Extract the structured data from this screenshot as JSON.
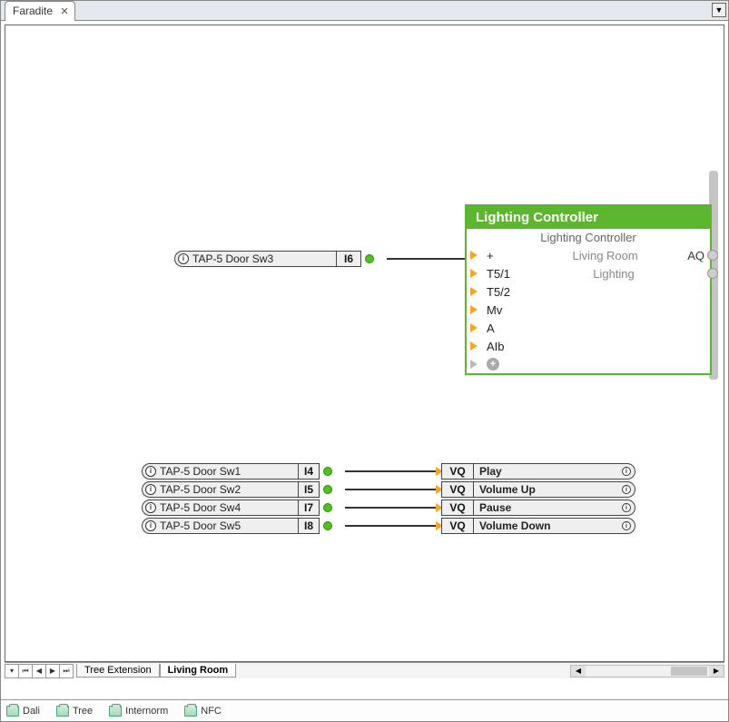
{
  "topTab": {
    "label": "Faradite"
  },
  "inputs": {
    "sw3": {
      "label": "TAP-5 Door Sw3",
      "port": "I6"
    },
    "sw1": {
      "label": "TAP-5 Door Sw1",
      "port": "I4"
    },
    "sw2": {
      "label": "TAP-5 Door Sw2",
      "port": "I5"
    },
    "sw4": {
      "label": "TAP-5 Door Sw4",
      "port": "I7"
    },
    "sw5": {
      "label": "TAP-5 Door Sw5",
      "port": "I8"
    }
  },
  "controller": {
    "title": "Lighting Controller",
    "subtitle": "Lighting Controller",
    "rows": [
      {
        "k": "+",
        "c": "Living Room",
        "r": "AQ"
      },
      {
        "k": "T5/1",
        "c": "Lighting",
        "r": ""
      },
      {
        "k": "T5/2",
        "c": "",
        "r": ""
      },
      {
        "k": "Mv",
        "c": "",
        "r": ""
      },
      {
        "k": "A",
        "c": "",
        "r": ""
      },
      {
        "k": "AIb",
        "c": "",
        "r": ""
      }
    ]
  },
  "outputs": {
    "o1": {
      "port": "VQ",
      "label": "Play"
    },
    "o2": {
      "port": "VQ",
      "label": "Volume Up"
    },
    "o3": {
      "port": "VQ",
      "label": "Pause"
    },
    "o4": {
      "port": "VQ",
      "label": "Volume Down"
    }
  },
  "sheetTabs": {
    "t1": "Tree Extension",
    "t2": "Living Room"
  },
  "status": {
    "s1": "Dali",
    "s2": "Tree",
    "s3": "Internorm",
    "s4": "NFC"
  },
  "chart_data": {
    "type": "node-graph",
    "nodes": [
      {
        "id": "sw3",
        "label": "TAP-5 Door Sw3",
        "port": "I6",
        "kind": "input"
      },
      {
        "id": "sw1",
        "label": "TAP-5 Door Sw1",
        "port": "I4",
        "kind": "input"
      },
      {
        "id": "sw2",
        "label": "TAP-5 Door Sw2",
        "port": "I5",
        "kind": "input"
      },
      {
        "id": "sw4",
        "label": "TAP-5 Door Sw4",
        "port": "I7",
        "kind": "input"
      },
      {
        "id": "sw5",
        "label": "TAP-5 Door Sw5",
        "port": "I8",
        "kind": "input"
      },
      {
        "id": "ctl",
        "label": "Lighting Controller",
        "room": "Living Room",
        "category": "Lighting",
        "inputs": [
          "+",
          "T5/1",
          "T5/2",
          "Mv",
          "A",
          "AIb"
        ],
        "outputs": [
          "AQ"
        ],
        "kind": "block"
      },
      {
        "id": "o1",
        "port": "VQ",
        "label": "Play",
        "kind": "output"
      },
      {
        "id": "o2",
        "port": "VQ",
        "label": "Volume Up",
        "kind": "output"
      },
      {
        "id": "o3",
        "port": "VQ",
        "label": "Pause",
        "kind": "output"
      },
      {
        "id": "o4",
        "port": "VQ",
        "label": "Volume Down",
        "kind": "output"
      }
    ],
    "edges": [
      {
        "from": "sw3",
        "to": "ctl",
        "toPort": "+"
      },
      {
        "from": "sw1",
        "to": "o1"
      },
      {
        "from": "sw2",
        "to": "o2"
      },
      {
        "from": "sw4",
        "to": "o3"
      },
      {
        "from": "sw5",
        "to": "o4"
      }
    ]
  }
}
